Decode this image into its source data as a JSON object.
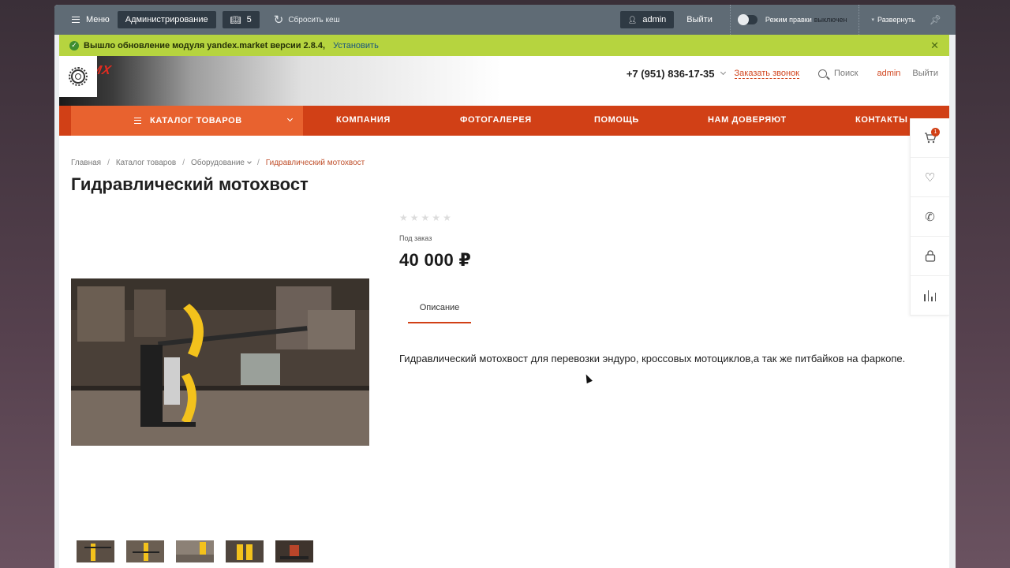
{
  "adminbar": {
    "menu_label": "Меню",
    "admin_label": "Администрирование",
    "notif_count": "5",
    "reset_cache": "Сбросить кеш",
    "user": "admin",
    "logout": "Выйти",
    "edit_mode_label": "Режим правки",
    "edit_mode_state": "выключен",
    "expand": "Развернуть"
  },
  "notice": {
    "text": "Вышло обновление модуля yandex.market версии 2.8.4,",
    "install": "Установить"
  },
  "header": {
    "logo": "MX",
    "phone": "+7 (951) 836-17-35",
    "callback": "Заказать звонок",
    "search": "Поиск",
    "user": "admin",
    "logout": "Выйти"
  },
  "nav": {
    "catalog": "КАТАЛОГ ТОВАРОВ",
    "items": [
      "КОМПАНИЯ",
      "ФОТОГАЛЕРЕЯ",
      "ПОМОЩЬ",
      "НАМ ДОВЕРЯЮТ",
      "КОНТАКТЫ"
    ]
  },
  "breadcrumbs": [
    "Главная",
    "Каталог товаров",
    "Оборудование",
    "Гидравлический мотохвост"
  ],
  "product": {
    "title": "Гидравлический мотохвост",
    "availability": "Под заказ",
    "price": "40 000 ₽",
    "rating": 0,
    "tab": "Описание",
    "description": "Гидравлический мотохвост для перевозки эндуро, кроссовых мотоциклов,а так же питбайков на фаркопе."
  },
  "cart_count": "1",
  "colors": {
    "accent": "#d14016",
    "catalog_bg": "#e8622f",
    "adminbar": "#5f6b75",
    "notice": "#b6d43f"
  }
}
